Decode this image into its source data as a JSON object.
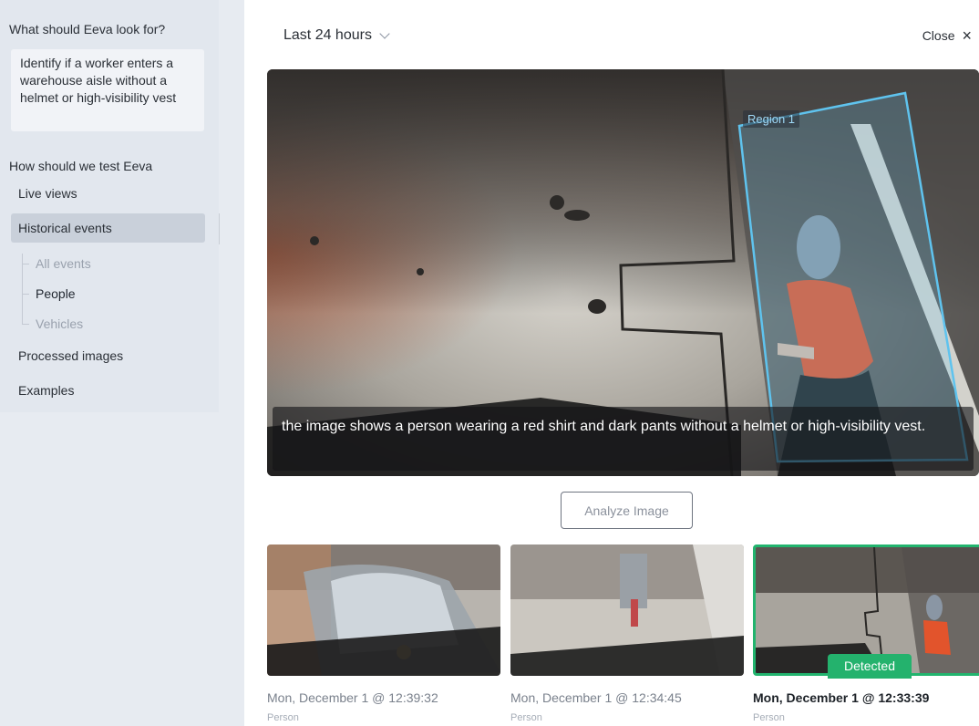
{
  "sidebar": {
    "prompt_label": "What should Eeva look for?",
    "prompt_text": "Identify if a worker enters a warehouse aisle without a helmet or high-visibility vest",
    "test_label": "How should we test Eeva",
    "nav": [
      {
        "label": "Live views",
        "active": false
      },
      {
        "label": "Historical events",
        "active": true
      },
      {
        "label": "Processed images",
        "active": false
      },
      {
        "label": "Examples",
        "active": false
      }
    ],
    "sub_items": [
      {
        "label": "All events",
        "current": false
      },
      {
        "label": "People",
        "current": true
      },
      {
        "label": "Vehicles",
        "current": false
      }
    ]
  },
  "header": {
    "range_label": "Last 24 hours",
    "close_label": "Close",
    "close_icon": "×"
  },
  "viewer": {
    "region_label": "Region 1",
    "caption": "the image shows a person wearing a red shirt and dark pants without a helmet or high-visibility vest."
  },
  "analyze_label": "Analyze Image",
  "thumbnails": [
    {
      "time": "Mon, December 1 @ 12:39:32",
      "category": "Person",
      "selected": false
    },
    {
      "time": "Mon, December 1 @ 12:34:45",
      "category": "Person",
      "selected": false
    },
    {
      "time": "Mon, December 1 @ 12:33:39",
      "category": "Person",
      "selected": true,
      "badge": "Detected"
    }
  ],
  "colors": {
    "accent_green": "#24b26d",
    "region_blue": "#5fc3ee",
    "sidebar_bg": "#e7ebf1"
  }
}
